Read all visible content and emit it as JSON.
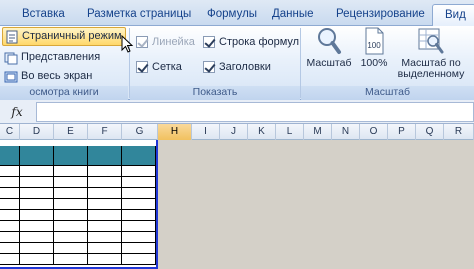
{
  "tabs": [
    {
      "label": "Вставка"
    },
    {
      "label": "Разметка страницы"
    },
    {
      "label": "Формулы"
    },
    {
      "label": "Данные"
    },
    {
      "label": "Рецензирование"
    },
    {
      "label": "Вид",
      "active": true
    }
  ],
  "ribbon": {
    "view_modes_group": {
      "caption": "осмотра книги",
      "items": [
        {
          "label": "Страничный режим",
          "icon": "page-layout-icon",
          "highlighted": true
        },
        {
          "label": "Представления",
          "icon": "views-icon"
        },
        {
          "label": "Во весь экран",
          "icon": "fullscreen-icon"
        }
      ]
    },
    "show_group": {
      "caption": "Показать",
      "checkboxes": [
        {
          "label": "Линейка",
          "checked": true,
          "disabled": true
        },
        {
          "label": "Строка формул",
          "checked": true,
          "disabled": false
        },
        {
          "label": "Сетка",
          "checked": true,
          "disabled": false
        },
        {
          "label": "Заголовки",
          "checked": true,
          "disabled": false
        }
      ]
    },
    "zoom_group": {
      "caption": "Масштаб",
      "buttons": [
        {
          "label": "Масштаб",
          "icon": "magnifier-icon"
        },
        {
          "label": "100%",
          "icon": "zoom-100-icon"
        },
        {
          "label_line1": "Масштаб по",
          "label_line2": "выделенному",
          "icon": "zoom-selection-icon"
        }
      ]
    }
  },
  "formula_bar": {
    "fx_label": "fx",
    "value": ""
  },
  "column_headers": [
    "C",
    "D",
    "E",
    "F",
    "G",
    "H",
    "I",
    "J",
    "K",
    "L",
    "M",
    "N",
    "O",
    "P",
    "Q",
    "R"
  ],
  "selected_column": "H",
  "colors": {
    "table_header_fill": "#31869b",
    "page_break_border": "#1f36d6",
    "selected_button": "#ffd86a",
    "accent": "#15428b"
  }
}
